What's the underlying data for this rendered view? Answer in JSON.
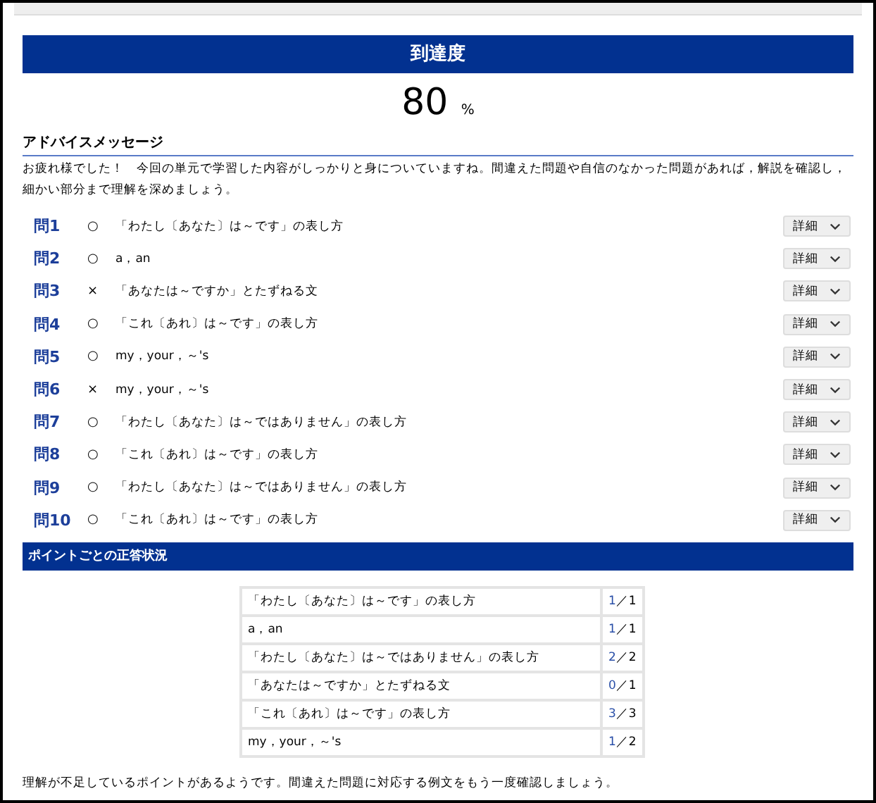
{
  "header": {
    "title": "到達度"
  },
  "score": {
    "value": "80",
    "unit": "%"
  },
  "advice": {
    "heading": "アドバイスメッセージ",
    "message": "お疲れ様でした！　今回の単元で学習した内容がしっかりと身についていますね。間違えた問題や自信のなかった問題があれば，解説を確認し，細かい部分まで理解を深めましょう。"
  },
  "questions": [
    {
      "number": "問1",
      "mark": "○",
      "topic": "「わたし〔あなた〕は～です」の表し方",
      "button": "詳細"
    },
    {
      "number": "問2",
      "mark": "○",
      "topic": "a，an",
      "button": "詳細"
    },
    {
      "number": "問3",
      "mark": "×",
      "topic": "「あなたは～ですか」とたずねる文",
      "button": "詳細"
    },
    {
      "number": "問4",
      "mark": "○",
      "topic": "「これ〔あれ〕は～です」の表し方",
      "button": "詳細"
    },
    {
      "number": "問5",
      "mark": "○",
      "topic": "my，your，～'s",
      "button": "詳細"
    },
    {
      "number": "問6",
      "mark": "×",
      "topic": "my，your，～'s",
      "button": "詳細"
    },
    {
      "number": "問7",
      "mark": "○",
      "topic": "「わたし〔あなた〕は～ではありません」の表し方",
      "button": "詳細"
    },
    {
      "number": "問8",
      "mark": "○",
      "topic": "「これ〔あれ〕は～です」の表し方",
      "button": "詳細"
    },
    {
      "number": "問9",
      "mark": "○",
      "topic": "「わたし〔あなた〕は～ではありません」の表し方",
      "button": "詳細"
    },
    {
      "number": "問10",
      "mark": "○",
      "topic": "「これ〔あれ〕は～です」の表し方",
      "button": "詳細"
    }
  ],
  "points": {
    "title": "ポイントごとの正答状況",
    "rows": [
      {
        "topic": "「わたし〔あなた〕は～です」の表し方",
        "correct": "1",
        "out_of": "／1"
      },
      {
        "topic": "a，an",
        "correct": "1",
        "out_of": "／1"
      },
      {
        "topic": "「わたし〔あなた〕は～ではありません」の表し方",
        "correct": "2",
        "out_of": "／2"
      },
      {
        "topic": "「あなたは～ですか」とたずねる文",
        "correct": "0",
        "out_of": "／1"
      },
      {
        "topic": "「これ〔あれ〕は～です」の表し方",
        "correct": "3",
        "out_of": "／3"
      },
      {
        "topic": "my，your，～'s",
        "correct": "1",
        "out_of": "／2"
      }
    ]
  },
  "footer": {
    "message": "理解が不足しているポイントがあるようです。間違えた問題に対応する例文をもう一度確認しましょう。"
  }
}
